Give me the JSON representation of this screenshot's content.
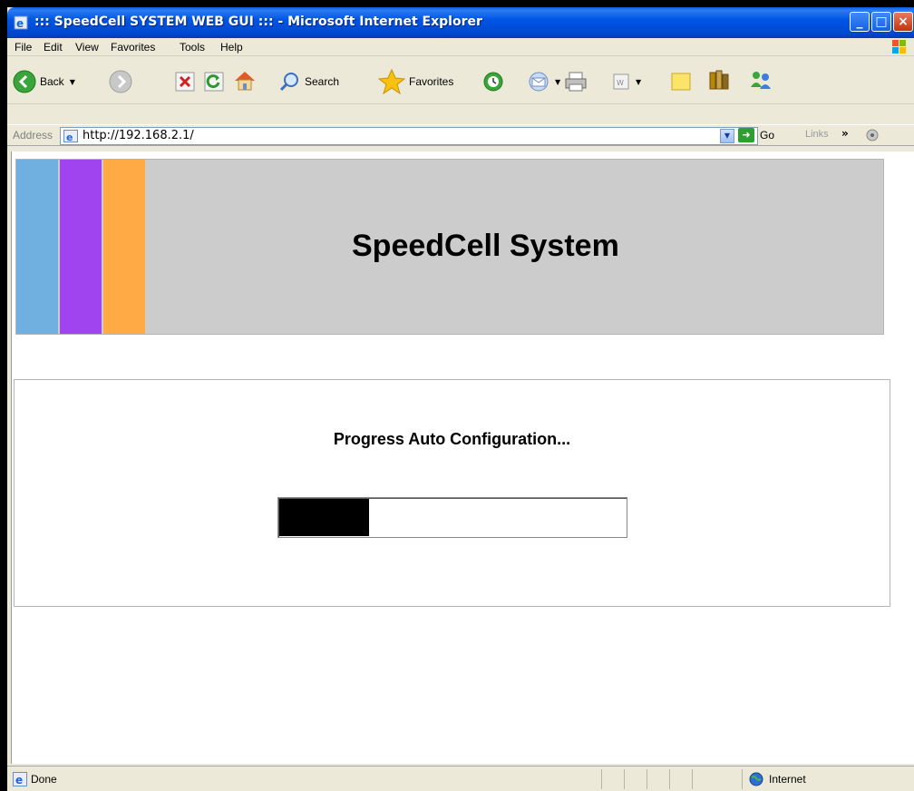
{
  "window": {
    "title": "::: SpeedCell SYSTEM WEB GUI ::: - Microsoft Internet Explorer"
  },
  "menu": {
    "items": [
      {
        "label": "File"
      },
      {
        "label": "Edit"
      },
      {
        "label": "View"
      },
      {
        "label": "Favorites"
      },
      {
        "label": "Tools"
      },
      {
        "label": "Help"
      }
    ]
  },
  "toolbar": {
    "back_label": "Back",
    "search_label": "Search",
    "favorites_label": "Favorites"
  },
  "address": {
    "label": "Address",
    "url": "http://192.168.2.1/",
    "go_label": "Go",
    "links_label": "Links"
  },
  "page": {
    "banner_title": "SpeedCell System",
    "stripe_colors": [
      "#70b0e0",
      "#a044f0",
      "#ffaa44"
    ],
    "progress_title": "Progress Auto Configuration...",
    "progress_fraction": 0.26
  },
  "status": {
    "text": "Done",
    "zone": "Internet"
  }
}
